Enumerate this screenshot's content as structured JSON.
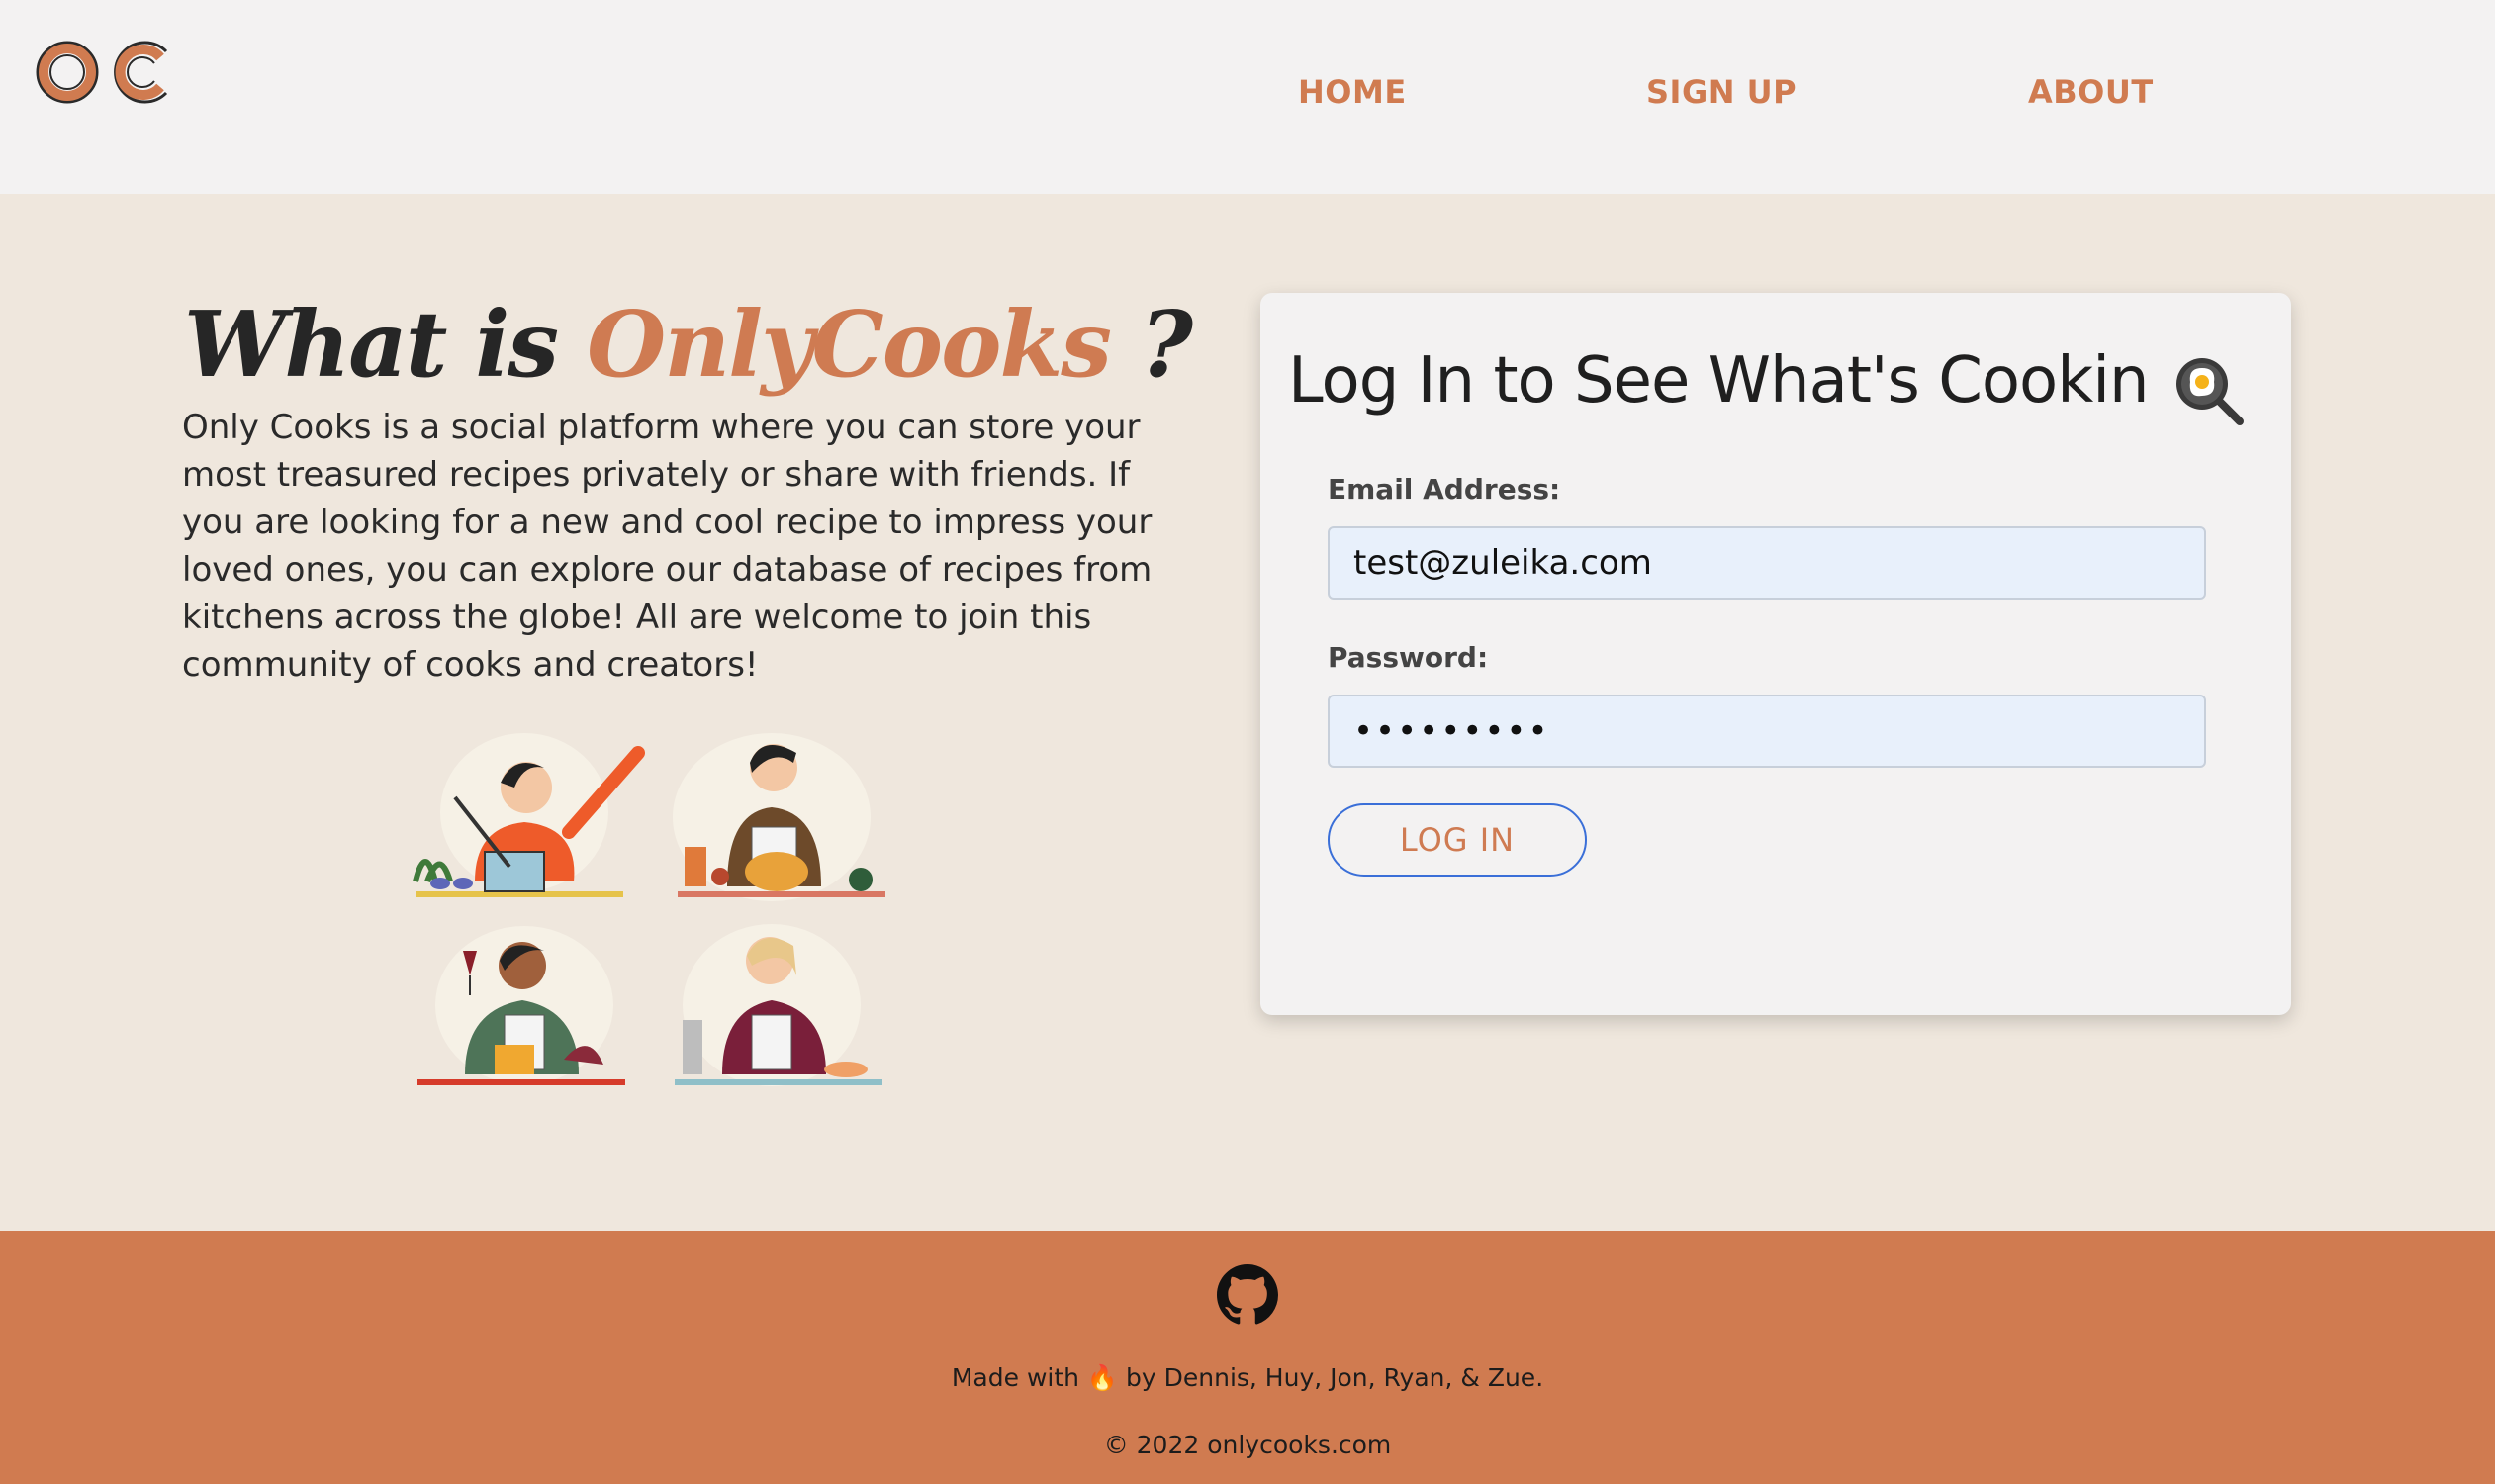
{
  "header": {
    "logo_text": "OC",
    "nav": [
      {
        "label": "HOME"
      },
      {
        "label": "SIGN UP"
      },
      {
        "label": "ABOUT"
      }
    ]
  },
  "hero": {
    "title_prefix": "What is",
    "title_brand": "OnlyCooks",
    "title_suffix": "?",
    "description": "Only Cooks is a social platform where you can store your most treasured recipes privately or share with friends. If you are looking for a new and cool recipe to impress your loved ones, you can explore our database of recipes from kitchens across the globe! All are welcome to join this community of cooks and creators!",
    "illustration_icons": [
      "cook-stirring-pot-icon",
      "cook-roast-chicken-icon",
      "cook-wine-glass-icon",
      "cook-tasting-icon"
    ]
  },
  "login": {
    "title": "Log In to See What's Cookin",
    "title_icon": "frying-pan-egg-icon",
    "email_label": "Email Address:",
    "email_value": "test@zuleika.com",
    "password_label": "Password:",
    "password_value": "•••••••••",
    "button_label": "LOG IN"
  },
  "footer": {
    "github_icon": "github-icon",
    "made_with": "Made with 🔥 by Dennis, Huy, Jon, Ryan, & Zue.",
    "copyright": "© 2022 onlycooks.com"
  },
  "colors": {
    "accent": "#d07b50",
    "background": "#efe7dd",
    "header_bg": "#f3f2f2",
    "card_bg": "#f3f2f2",
    "input_bg": "#e8f0fb",
    "button_border": "#3a6fd8"
  }
}
